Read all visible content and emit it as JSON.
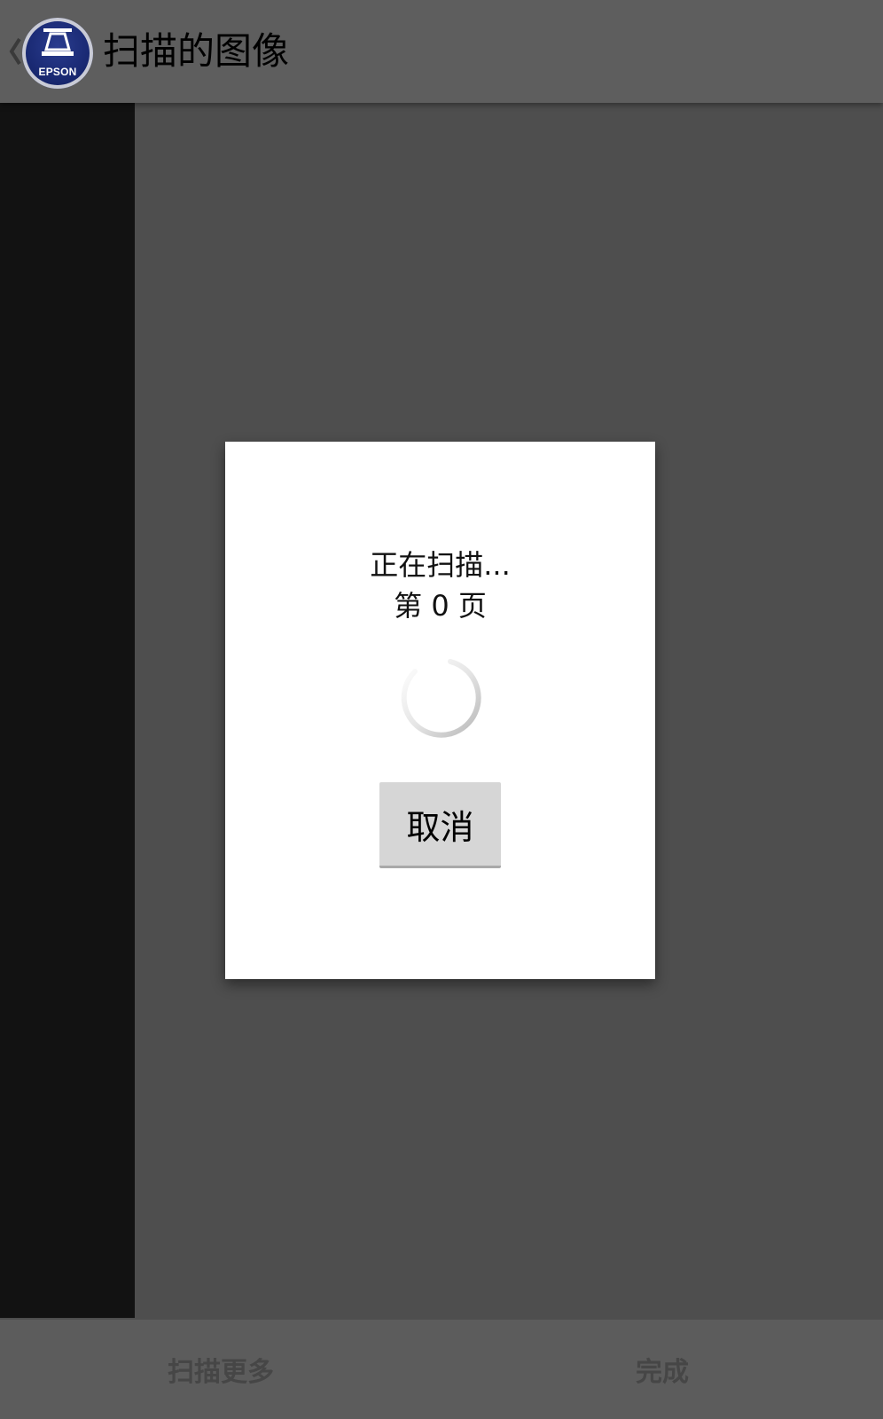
{
  "header": {
    "title": "扫描的图像",
    "back_icon": "chevron-left-icon",
    "logo_brand": "EPSON"
  },
  "dialog": {
    "status_line": "正在扫描...",
    "page_line": "第 0 页",
    "spinner_icon": "loading-spinner-icon",
    "cancel_label": "取消"
  },
  "bottom_bar": {
    "scan_more_label": "扫描更多",
    "done_label": "完成"
  },
  "colors": {
    "top_bar": "#5e5e5e",
    "left_panel": "#121212",
    "preview_background": "#4e4e4e",
    "bottom_bar": "#5c5c5c",
    "logo_blue": "#1a2a74",
    "dialog_background": "#ffffff",
    "cancel_button": "#d6d6d6"
  }
}
